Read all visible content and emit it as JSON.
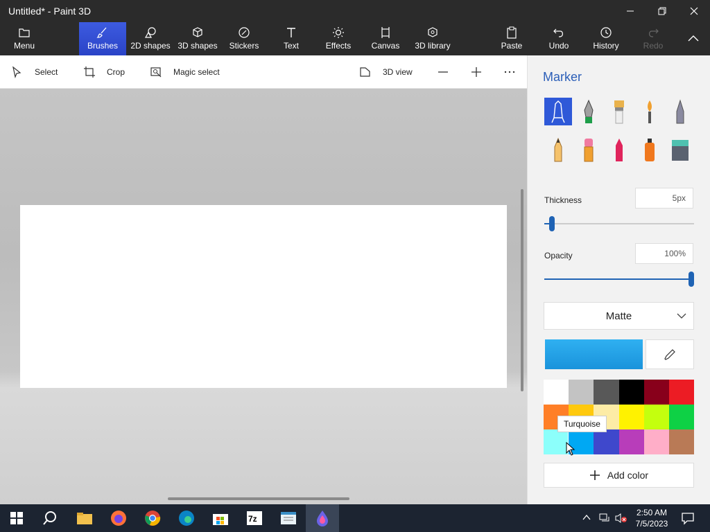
{
  "window": {
    "title": "Untitled* - Paint 3D"
  },
  "ribbon": {
    "menu": "Menu",
    "items": [
      "Brushes",
      "2D shapes",
      "3D shapes",
      "Stickers",
      "Text",
      "Effects",
      "Canvas",
      "3D library"
    ],
    "right": [
      "Paste",
      "Undo",
      "History",
      "Redo"
    ]
  },
  "toolbar": {
    "select": "Select",
    "crop": "Crop",
    "magic": "Magic select",
    "view3d": "3D view"
  },
  "panel": {
    "title": "Marker",
    "brushes": [
      "Marker",
      "Calligraphy pen",
      "Oil brush",
      "Watercolor",
      "Pixel pen",
      "Pencil",
      "Eraser",
      "Crayon",
      "Spray can",
      "Fill"
    ],
    "thickness_label": "Thickness",
    "thickness_value": "5px",
    "thickness_fraction": 0.05,
    "opacity_label": "Opacity",
    "opacity_value": "100%",
    "opacity_fraction": 1.0,
    "finish": "Matte",
    "current_color": "#1a93db",
    "palette": [
      "#ffffff",
      "#c3c3c3",
      "#585858",
      "#000000",
      "#88001b",
      "#ec1c24",
      "#ff7f27",
      "#ffc90e",
      "#fdeca6",
      "#fff200",
      "#c4ff0e",
      "#0ed145",
      "#8cfffb",
      "#00a8f3",
      "#3f48cc",
      "#b83dba",
      "#ffaec8",
      "#b97a56"
    ],
    "tooltip": "Turquoise",
    "add_color": "Add color"
  },
  "taskbar": {
    "time": "2:50 AM",
    "date": "7/5/2023"
  }
}
